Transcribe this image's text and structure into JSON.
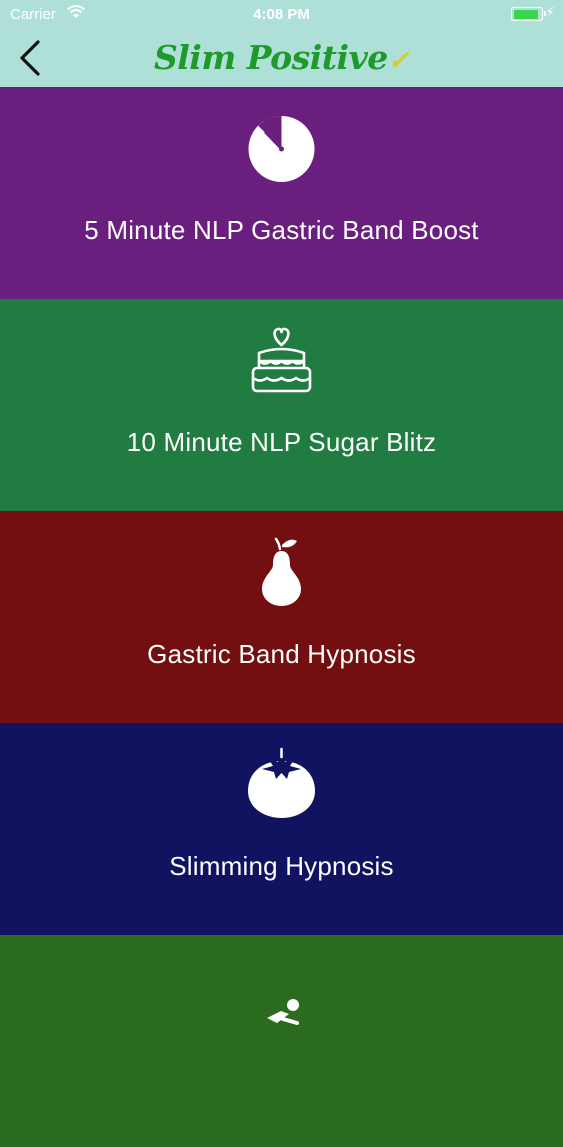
{
  "status_bar": {
    "carrier": "Carrier",
    "time": "4:08 PM",
    "battery_level": 0.9,
    "icons": [
      "wifi-icon",
      "battery-icon",
      "charging-bolt-icon"
    ]
  },
  "nav_bar": {
    "back_icon": "chevron-left-icon",
    "logo_text": "Slim Positive",
    "logo_color": "#1e9a2a",
    "background": "#aee0d8"
  },
  "menu": {
    "items": [
      {
        "label": "5 Minute NLP Gastric Band Boost",
        "icon": "timer-icon",
        "color": "#6a1f7e"
      },
      {
        "label": "10 Minute NLP Sugar Blitz",
        "icon": "cake-icon",
        "color": "#217c42"
      },
      {
        "label": "Gastric Band Hypnosis",
        "icon": "pear-icon",
        "color": "#730f10"
      },
      {
        "label": "Slimming Hypnosis",
        "icon": "tomato-icon",
        "color": "#111361"
      },
      {
        "label": "",
        "icon": "runner-icon",
        "color": "#2b6b1f"
      }
    ]
  }
}
